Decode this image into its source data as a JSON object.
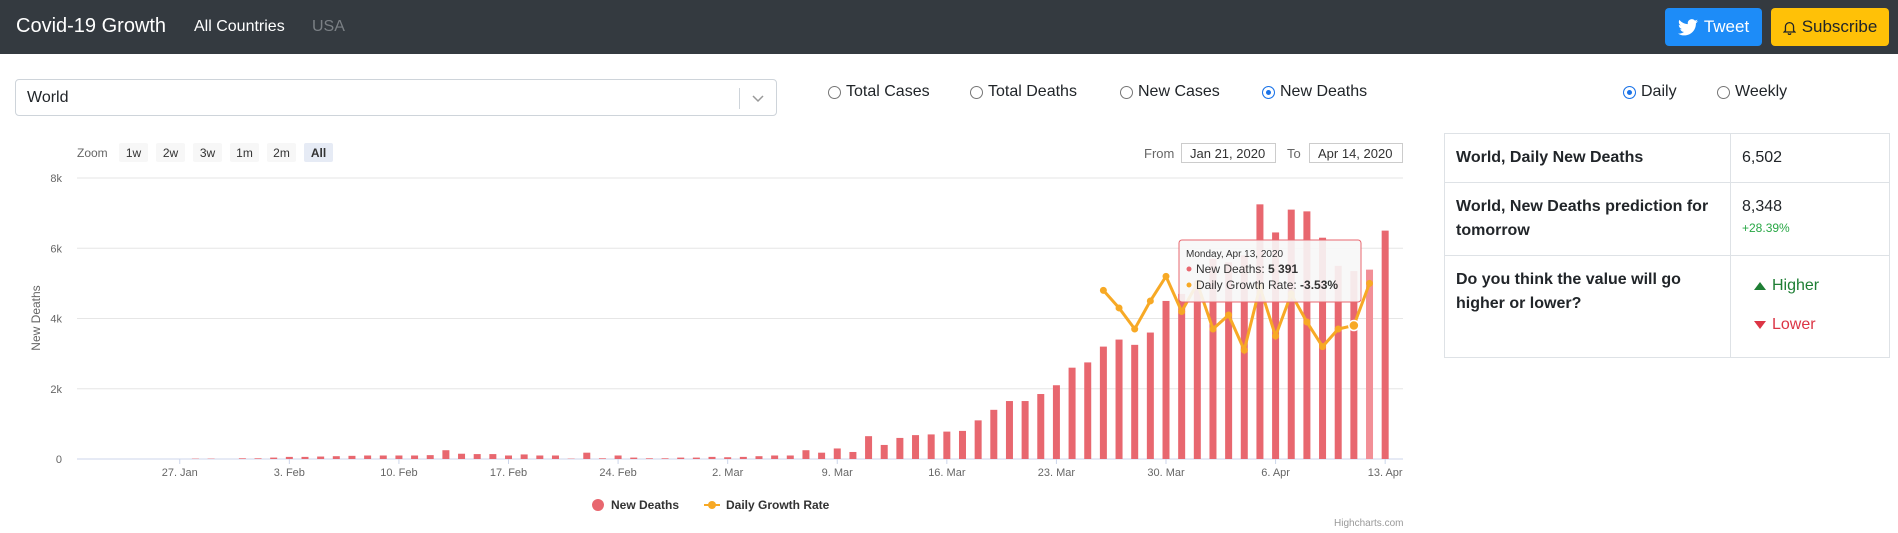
{
  "nav": {
    "brand": "Covid-19 Growth",
    "links": [
      "All Countries",
      "USA"
    ],
    "tweet": "Tweet",
    "subscribe": "Subscribe"
  },
  "selector": {
    "value": "World"
  },
  "metrics": {
    "options": [
      "Total Cases",
      "Total Deaths",
      "New Cases",
      "New Deaths"
    ],
    "selected": "New Deaths"
  },
  "period": {
    "options": [
      "Daily",
      "Weekly"
    ],
    "selected": "Daily"
  },
  "zoom": {
    "label": "Zoom",
    "buttons": [
      "1w",
      "2w",
      "3w",
      "1m",
      "2m",
      "All"
    ],
    "active": "All"
  },
  "range": {
    "from_label": "From",
    "from": "Jan 21, 2020",
    "to_label": "To",
    "to": "Apr 14, 2020"
  },
  "stats": {
    "daily_label": "World, Daily New Deaths",
    "daily_value": "6,502",
    "prediction_label": "World, New Deaths prediction for tomorrow",
    "prediction_value": "8,348",
    "prediction_change": "+28.39%",
    "question": "Do you think the value will go higher or lower?",
    "higher": "Higher",
    "lower": "Lower"
  },
  "credits": "Highcharts.com",
  "colors": {
    "bar": "#e8676f",
    "line": "#f7a925",
    "navbar": "#343a40",
    "tweet": "#1d8cf8",
    "subscribe": "#ffc107"
  },
  "chart_data": {
    "type": "bar",
    "ylabel": "New Deaths",
    "ylim": [
      0,
      8000
    ],
    "yticks": [
      "0",
      "2k",
      "4k",
      "6k",
      "8k"
    ],
    "xtick_labels": [
      "27. Jan",
      "3. Feb",
      "10. Feb",
      "17. Feb",
      "24. Feb",
      "2. Mar",
      "9. Mar",
      "16. Mar",
      "23. Mar",
      "30. Mar",
      "6. Apr",
      "13. Apr"
    ],
    "xtick_dates": [
      "Jan 27",
      "Feb 3",
      "Feb 10",
      "Feb 17",
      "Feb 24",
      "Mar 2",
      "Mar 9",
      "Mar 16",
      "Mar 23",
      "Mar 30",
      "Apr 6",
      "Apr 13"
    ],
    "start_date": "Jan 21",
    "series": [
      {
        "name": "New Deaths",
        "type": "column",
        "values": [
          0,
          0,
          0,
          0,
          0,
          0,
          0,
          10,
          10,
          0,
          20,
          20,
          40,
          60,
          60,
          70,
          80,
          90,
          100,
          100,
          100,
          100,
          110,
          250,
          150,
          140,
          140,
          100,
          130,
          100,
          100,
          10,
          180,
          20,
          100,
          40,
          20,
          20,
          40,
          40,
          60,
          50,
          60,
          80,
          100,
          100,
          250,
          180,
          300,
          200,
          650,
          400,
          600,
          680,
          700,
          780,
          800,
          1100,
          1400,
          1650,
          1650,
          1850,
          2100,
          2600,
          2750,
          3200,
          3400,
          3250,
          3600,
          4500,
          4700,
          5000,
          5700,
          5600,
          5800,
          7250,
          6450,
          7100,
          7050,
          6300,
          5500,
          5350,
          5391,
          6502
        ]
      },
      {
        "name": "Daily Growth Rate",
        "type": "line",
        "values": [
          null,
          null,
          null,
          null,
          null,
          null,
          null,
          null,
          null,
          null,
          null,
          null,
          null,
          null,
          null,
          null,
          null,
          null,
          null,
          null,
          null,
          null,
          null,
          null,
          null,
          null,
          null,
          null,
          null,
          null,
          null,
          null,
          null,
          null,
          null,
          null,
          null,
          null,
          null,
          null,
          null,
          null,
          null,
          null,
          null,
          null,
          null,
          null,
          null,
          null,
          null,
          null,
          null,
          null,
          null,
          null,
          null,
          null,
          null,
          null,
          null,
          null,
          null,
          null,
          null,
          4.8,
          4.3,
          3.7,
          4.5,
          5.2,
          4.2,
          5.0,
          3.7,
          4.1,
          3.1,
          4.9,
          3.5,
          4.7,
          3.9,
          3.2,
          3.7,
          3.8,
          5.0,
          null
        ]
      }
    ],
    "tooltip": {
      "date": "Monday, Apr 13, 2020",
      "lines": [
        {
          "label": "New Deaths:",
          "value": "5 391"
        },
        {
          "label": "Daily Growth Rate:",
          "value": "-3.53%"
        }
      ]
    },
    "legend": [
      "New Deaths",
      "Daily Growth Rate"
    ],
    "legend_position": "bottom-center",
    "grid": true
  }
}
